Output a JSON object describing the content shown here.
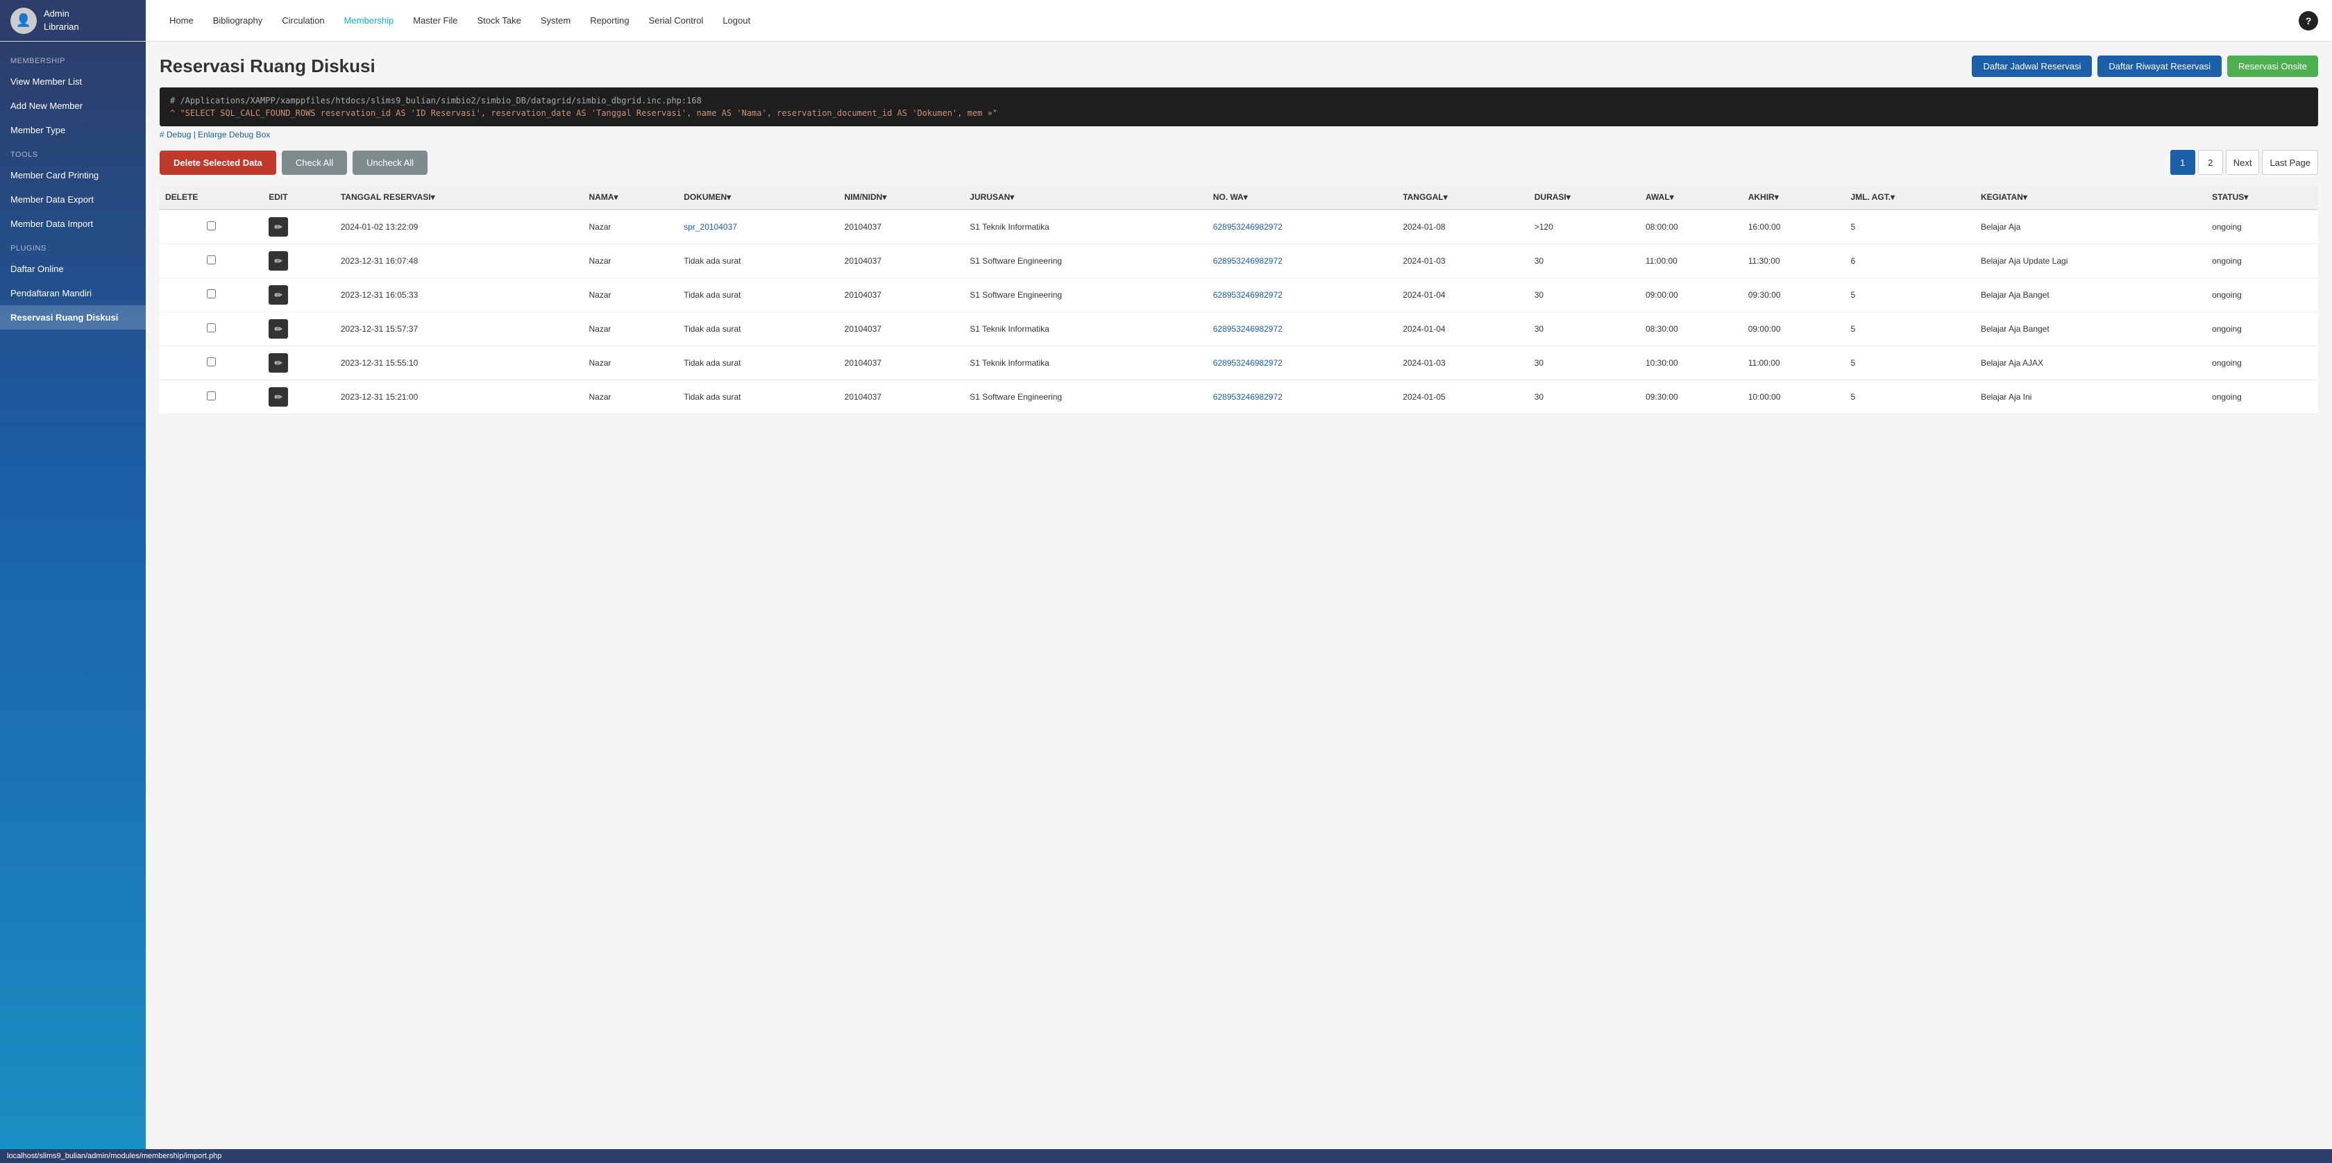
{
  "brand": {
    "name": "Admin",
    "role": "Librarian",
    "avatar_char": "👤"
  },
  "nav": {
    "links": [
      {
        "label": "Home",
        "active": false
      },
      {
        "label": "Bibliography",
        "active": false
      },
      {
        "label": "Circulation",
        "active": false
      },
      {
        "label": "Membership",
        "active": true
      },
      {
        "label": "Master File",
        "active": false
      },
      {
        "label": "Stock Take",
        "active": false
      },
      {
        "label": "System",
        "active": false
      },
      {
        "label": "Reporting",
        "active": false
      },
      {
        "label": "Serial Control",
        "active": false
      },
      {
        "label": "Logout",
        "active": false
      }
    ],
    "help_label": "?"
  },
  "sidebar": {
    "membership_label": "MEMBERSHIP",
    "membership_items": [
      {
        "label": "View Member List",
        "active": false
      },
      {
        "label": "Add New Member",
        "active": false
      },
      {
        "label": "Member Type",
        "active": false
      }
    ],
    "tools_label": "TOOLS",
    "tools_items": [
      {
        "label": "Member Card Printing",
        "active": false
      },
      {
        "label": "Member Data Export",
        "active": false
      },
      {
        "label": "Member Data Import",
        "active": false
      }
    ],
    "plugins_label": "PLUGINS",
    "plugins_items": [
      {
        "label": "Daftar Online",
        "active": false
      },
      {
        "label": "Pendaftaran Mandiri",
        "active": false
      },
      {
        "label": "Reservasi Ruang Diskusi",
        "active": true
      }
    ]
  },
  "page": {
    "title": "Reservasi Ruang Diskusi",
    "btn_jadwal": "Daftar Jadwal Reservasi",
    "btn_riwayat": "Daftar Riwayat Reservasi",
    "btn_onsite": "Reservasi Onsite"
  },
  "debug": {
    "path": "# /Applications/XAMPP/xamppfiles/htdocs/slims9_bulian/simbio2/simbio_DB/datagrid/simbio_dbgrid.inc.php:168",
    "sql": "^ \"SELECT SQL_CALC_FOUND_ROWS  reservation_id AS 'ID Reservasi', reservation_date AS 'Tanggal Reservasi', name AS 'Nama', reservation_document_id AS 'Dokumen', mem »\"",
    "debug_label": "# Debug |",
    "debug_link": "Enlarge Debug Box"
  },
  "toolbar": {
    "delete_label": "Delete Selected Data",
    "check_all_label": "Check All",
    "uncheck_all_label": "Uncheck All"
  },
  "pagination": {
    "pages": [
      "1",
      "2",
      "Next",
      "Last Page"
    ],
    "active_page": "1"
  },
  "table": {
    "columns": [
      "DELETE",
      "EDIT",
      "TANGGAL RESERVASI▾",
      "NAMA▾",
      "DOKUMEN▾",
      "NIM/NIDN▾",
      "JURUSAN▾",
      "NO. WA▾",
      "TANGGAL▾",
      "DURASI▾",
      "AWAL▾",
      "AKHIR▾",
      "JML. AGT.▾",
      "KEGIATAN▾",
      "STATUS▾"
    ],
    "rows": [
      {
        "tanggal_reservasi": "2024-01-02 13:22:09",
        "nama": "Nazar",
        "dokumen": "spr_20104037",
        "dokumen_link": true,
        "nim": "20104037",
        "jurusan": "S1 Teknik Informatika",
        "no_wa": "628953246982972",
        "tanggal": "2024-01-08",
        "durasi": ">120",
        "awal": "08:00:00",
        "akhir": "16:00:00",
        "jml_agt": "5",
        "kegiatan": "Belajar Aja",
        "status": "ongoing"
      },
      {
        "tanggal_reservasi": "2023-12-31 16:07:48",
        "nama": "Nazar",
        "dokumen": "Tidak ada surat",
        "dokumen_link": false,
        "nim": "20104037",
        "jurusan": "S1 Software Engineering",
        "no_wa": "628953246982972",
        "tanggal": "2024-01-03",
        "durasi": "30",
        "awal": "11:00:00",
        "akhir": "11:30:00",
        "jml_agt": "6",
        "kegiatan": "Belajar Aja Update Lagi",
        "status": "ongoing"
      },
      {
        "tanggal_reservasi": "2023-12-31 16:05:33",
        "nama": "Nazar",
        "dokumen": "Tidak ada surat",
        "dokumen_link": false,
        "nim": "20104037",
        "jurusan": "S1 Software Engineering",
        "no_wa": "628953246982972",
        "tanggal": "2024-01-04",
        "durasi": "30",
        "awal": "09:00:00",
        "akhir": "09:30:00",
        "jml_agt": "5",
        "kegiatan": "Belajar Aja Banget",
        "status": "ongoing"
      },
      {
        "tanggal_reservasi": "2023-12-31 15:57:37",
        "nama": "Nazar",
        "dokumen": "Tidak ada surat",
        "dokumen_link": false,
        "nim": "20104037",
        "jurusan": "S1 Teknik Informatika",
        "no_wa": "628953246982972",
        "tanggal": "2024-01-04",
        "durasi": "30",
        "awal": "08:30:00",
        "akhir": "09:00:00",
        "jml_agt": "5",
        "kegiatan": "Belajar Aja Banget",
        "status": "ongoing"
      },
      {
        "tanggal_reservasi": "2023-12-31 15:55:10",
        "nama": "Nazar",
        "dokumen": "Tidak ada surat",
        "dokumen_link": false,
        "nim": "20104037",
        "jurusan": "S1 Teknik Informatika",
        "no_wa": "628953246982972",
        "tanggal": "2024-01-03",
        "durasi": "30",
        "awal": "10:30:00",
        "akhir": "11:00:00",
        "jml_agt": "5",
        "kegiatan": "Belajar Aja AJAX",
        "status": "ongoing"
      },
      {
        "tanggal_reservasi": "2023-12-31 15:21:00",
        "nama": "Nazar",
        "dokumen": "Tidak ada surat",
        "dokumen_link": false,
        "nim": "20104037",
        "jurusan": "S1 Software Engineering",
        "no_wa": "628953246982972",
        "tanggal": "2024-01-05",
        "durasi": "30",
        "awal": "09:30:00",
        "akhir": "10:00:00",
        "jml_agt": "5",
        "kegiatan": "Belajar Aja Ini",
        "status": "ongoing"
      }
    ]
  },
  "statusbar": {
    "url": "localhost/slims9_bulian/admin/modules/membership/import.php"
  }
}
